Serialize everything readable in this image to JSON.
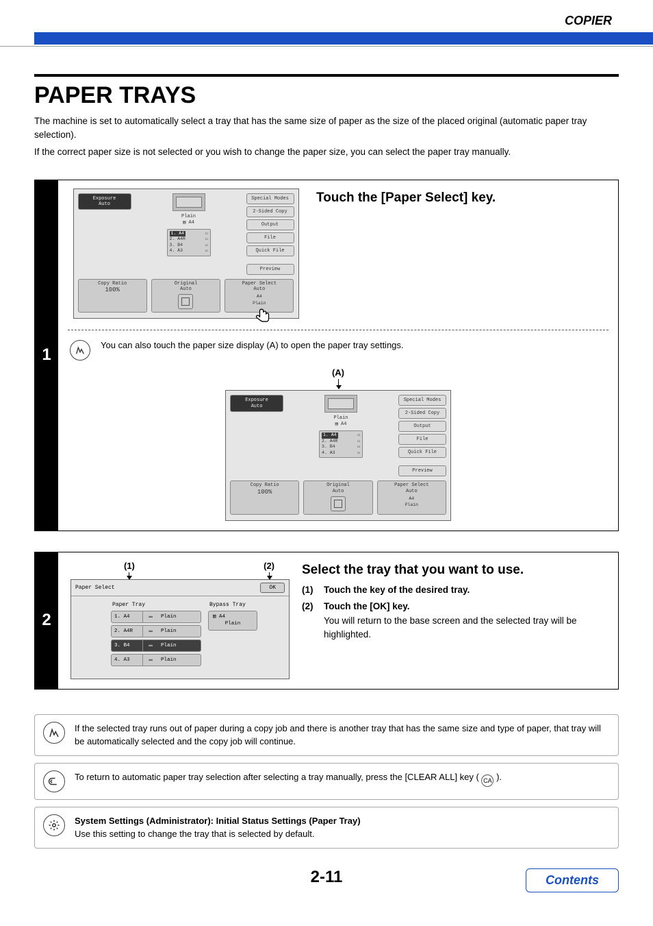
{
  "header": {
    "section": "COPIER"
  },
  "title": "PAPER TRAYS",
  "intro": [
    "The machine is set to automatically select a tray that has the same size of paper as the size of the placed original (automatic paper tray selection).",
    "If the correct paper size is not selected or you wish to change the paper size, you can select the paper tray manually."
  ],
  "steps": [
    {
      "num": "1",
      "heading": "Touch the [Paper Select] key.",
      "note": "You can also touch the paper size display (A) to open the paper tray settings.",
      "callout_a": "(A)"
    },
    {
      "num": "2",
      "heading": "Select the tray that you want to use.",
      "callouts": [
        "(1)",
        "(2)"
      ],
      "items": [
        {
          "num": "(1)",
          "head": "Touch the key of the desired tray."
        },
        {
          "num": "(2)",
          "head": "Touch the [OK] key.",
          "sub": "You will return to the base screen and the selected tray will be highlighted."
        }
      ]
    }
  ],
  "screen": {
    "exposure_label": "Exposure",
    "exposure_value": "Auto",
    "paper_type": "Plain",
    "paper_size": "A4",
    "tray_mini": [
      {
        "label": "1. A4"
      },
      {
        "label": "2. A4R"
      },
      {
        "label": "3. B4"
      },
      {
        "label": "4. A3"
      }
    ],
    "right": [
      "Special Modes",
      "2-Sided Copy",
      "Output",
      "File",
      "Quick File",
      "Preview"
    ],
    "trio": [
      {
        "label": "Copy Ratio",
        "value": "100%"
      },
      {
        "label": "Original",
        "value": "Auto"
      },
      {
        "label": "Paper Select",
        "value": "Auto",
        "sub1": "A4",
        "sub2": "Plain"
      }
    ]
  },
  "select_screen": {
    "title": "Paper Select",
    "ok": "OK",
    "col_paper": "Paper Tray",
    "col_bypass": "Bypass Tray",
    "trays": [
      {
        "name": "1. A4",
        "type": "Plain"
      },
      {
        "name": "2. A4R",
        "type": "Plain"
      },
      {
        "name": "3. B4",
        "type": "Plain"
      },
      {
        "name": "4. A3",
        "type": "Plain"
      }
    ],
    "bypass": {
      "size": "A4",
      "type": "Plain"
    }
  },
  "notes": [
    "If the selected tray runs out of paper during a copy job and there is another tray that has the same size and type of paper, that tray will be automatically selected and the copy job will continue.",
    {
      "pre": "To return to automatic paper tray selection after selecting a tray manually, press the [CLEAR ALL] key ( ",
      "icon": "CA",
      "post": " )."
    },
    {
      "bold": "System Settings (Administrator): Initial Status Settings (Paper Tray)",
      "body": "Use this setting to change the tray that is selected by default."
    }
  ],
  "page_number": "2-11",
  "contents_label": "Contents"
}
